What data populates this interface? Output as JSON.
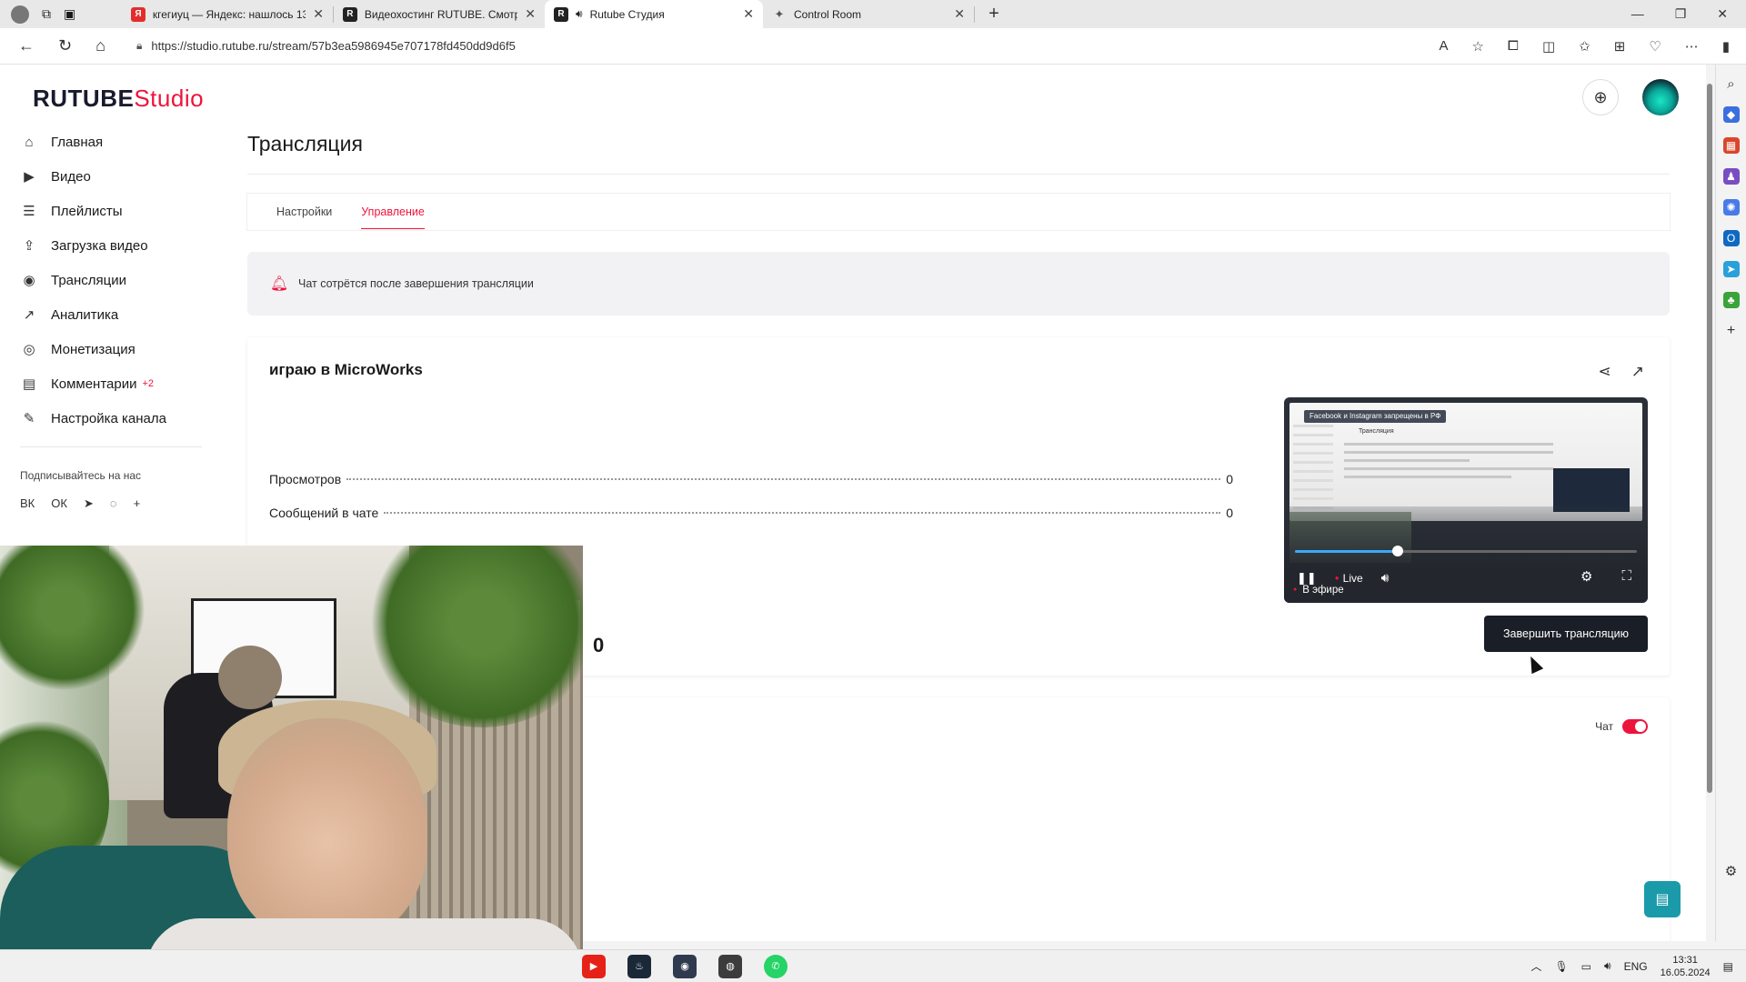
{
  "browser": {
    "tabs": [
      {
        "title": "кгегиуц — Яндекс: нашлось 13…",
        "favicon": "Я",
        "color": "#e32d2d",
        "active": false
      },
      {
        "title": "Видеохостинг RUTUBE. Смотри…",
        "favicon": "R",
        "color": "#222222",
        "active": false
      },
      {
        "title": "Rutube Студия",
        "favicon": "R",
        "color": "#222222",
        "active": true
      },
      {
        "title": "Control Room",
        "favicon": "✦",
        "color": "#555555",
        "active": false
      }
    ],
    "url": "https://studio.rutube.ru/stream/57b3ea5986945e707178fd450dd9d6f5"
  },
  "brand": {
    "name": "RUTUBE",
    "suffix": "Studio",
    "accent": "#ed143b"
  },
  "sidebar": {
    "items": [
      {
        "label": "Главная",
        "icon": "home-icon",
        "glyph": "⌂"
      },
      {
        "label": "Видео",
        "icon": "video-icon",
        "glyph": "▶"
      },
      {
        "label": "Плейлисты",
        "icon": "playlist-icon",
        "glyph": "☰"
      },
      {
        "label": "Загрузка видео",
        "icon": "upload-icon",
        "glyph": "⇪"
      },
      {
        "label": "Трансляции",
        "icon": "broadcast-icon",
        "glyph": "◉"
      },
      {
        "label": "Аналитика",
        "icon": "analytics-icon",
        "glyph": "↗"
      },
      {
        "label": "Монетизация",
        "icon": "money-icon",
        "glyph": "◎"
      },
      {
        "label": "Комментарии",
        "icon": "comments-icon",
        "glyph": "▤",
        "badge": "+2"
      },
      {
        "label": "Настройка канала",
        "icon": "wand-icon",
        "glyph": "✎"
      }
    ],
    "subscribe_label": "Подписывайтесь на нас",
    "socials": [
      "ВК",
      "ОК",
      "➤",
      "◌",
      "+"
    ]
  },
  "page": {
    "title": "Трансляция",
    "tabs": [
      {
        "label": "Настройки",
        "active": false
      },
      {
        "label": "Управление",
        "active": true
      }
    ],
    "notice": "Чат сотрётся после завершения трансляции"
  },
  "stream": {
    "title": "играю в MicroWorks",
    "stats": [
      {
        "label": "Просмотров",
        "value": "0"
      },
      {
        "label": "Сообщений в чате",
        "value": "0"
      }
    ],
    "big_value": "0",
    "end_button": "Завершить трансляцию",
    "progress": 0.3
  },
  "player": {
    "banner": "Facebook и Instagram запрещены в РФ",
    "live_label": "Live",
    "on_air_label": "В эфире",
    "preview_title": "Трансляция"
  },
  "chat": {
    "label": "Чат",
    "enabled": true
  },
  "taskbar": {
    "lang": "ENG",
    "time": "13:31",
    "date": "16.05.2024"
  }
}
